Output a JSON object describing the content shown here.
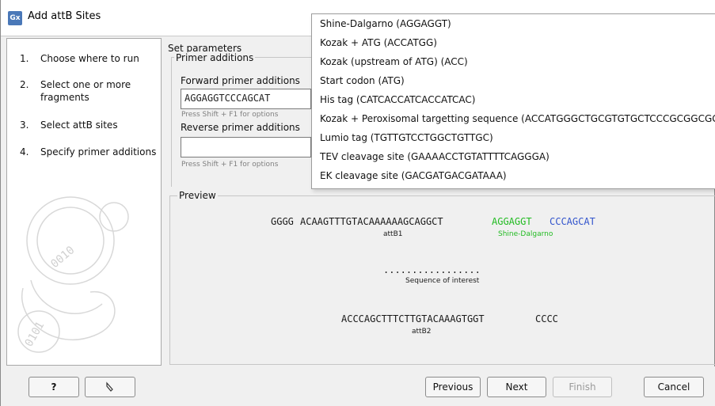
{
  "window": {
    "title": "Add attB Sites",
    "icon_text": "Gx"
  },
  "steps": [
    {
      "num": "1.",
      "label": "Choose where to run"
    },
    {
      "num": "2.",
      "label": "Select one or more fragments"
    },
    {
      "num": "3.",
      "label": "Select attB sites"
    },
    {
      "num": "4.",
      "label": "Specify primer additions"
    }
  ],
  "params": {
    "section_title": "Set parameters",
    "group_title": "Primer additions",
    "forward_label": "Forward primer additions",
    "forward_value": "AGGAGGTCCCAGCAT",
    "forward_hint": "Press Shift + F1 for options",
    "reverse_label": "Reverse primer additions",
    "reverse_value": "",
    "reverse_hint": "Press Shift + F1 for options"
  },
  "preview": {
    "title": "Preview",
    "line1_prefix": "GGGG",
    "line1_attb1": "ACAAGTTTGTACAAAAAAGCAGGCT",
    "line1_shine": "AGGAGGT",
    "line1_extra": "CCCAGCAT",
    "attb1_label": "attB1",
    "shine_label": "Shine-Dalgarno",
    "dots": ".................",
    "interest_label": "Sequence of interest",
    "line2_attb2": "ACCCAGCTTTCTTGTACAAAGTGGT",
    "line2_suffix": "CCCC",
    "attb2_label": "attB2"
  },
  "dropdown": {
    "items": [
      "Shine-Dalgarno (AGGAGGT)",
      "Kozak + ATG (ACCATGG)",
      "Kozak (upstream of ATG) (ACC)",
      "Start codon (ATG)",
      "His tag (CATCACCATCACCATCAC)",
      "Kozak + Peroxisomal targetting sequence (ACCATGGGCTGCGTGTGCTCCCGCGGCGGC",
      "Lumio tag (TGTTGTCCTGGCTGTTGC)",
      "TEV cleavage site (GAAAACCTGTATTTTCAGGGA)",
      "EK cleavage site (GACGATGACGATAAA)"
    ]
  },
  "buttons": {
    "help": "?",
    "previous": "Previous",
    "next": "Next",
    "finish": "Finish",
    "cancel": "Cancel"
  },
  "colors": {
    "shine_dalgarno": "#22bb22",
    "extra_sequence": "#3355cc"
  }
}
